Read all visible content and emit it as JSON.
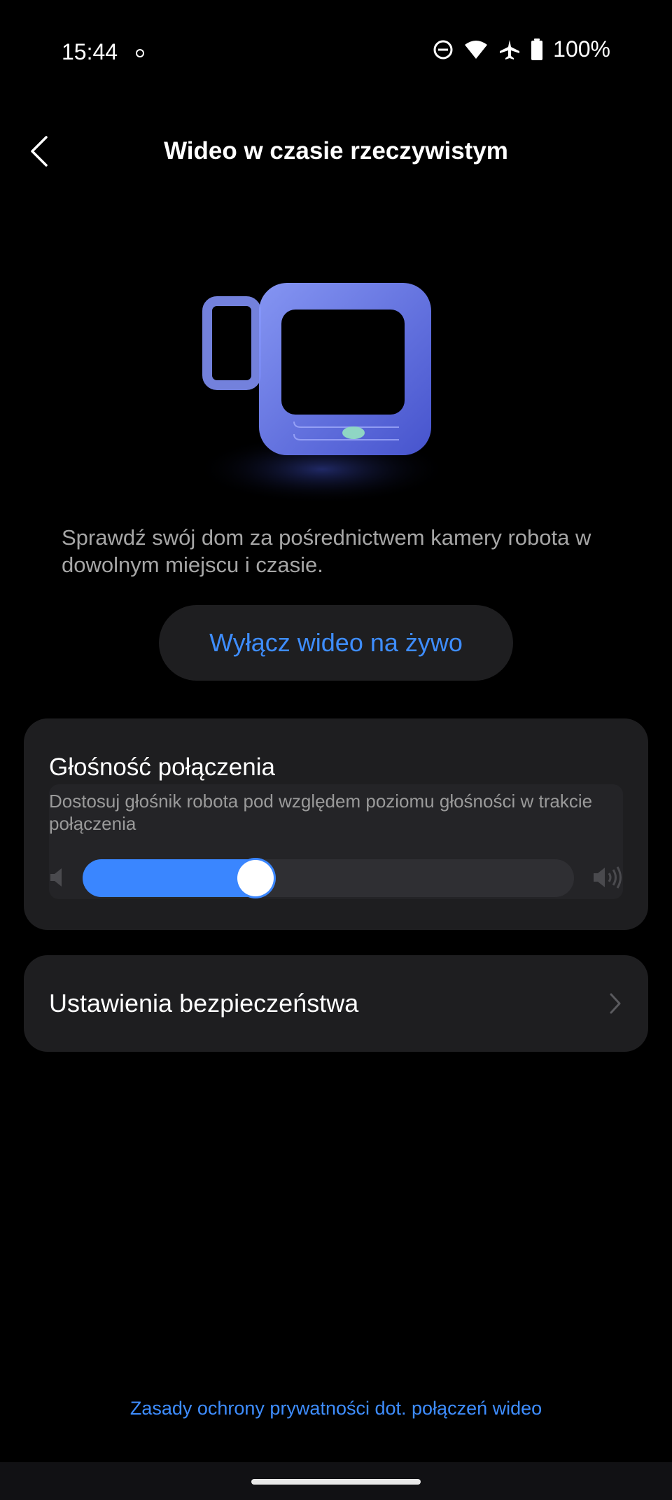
{
  "status_bar": {
    "time": "15:44",
    "battery": "100%",
    "icons": [
      "dnd-icon",
      "wifi-icon",
      "airplane-icon",
      "battery-icon"
    ]
  },
  "header": {
    "title": "Wideo w czasie rzeczywistym",
    "back_icon": "back-chevron-icon"
  },
  "main": {
    "description": "Sprawdź swój dom za pośrednictwem kamery robota w dowolnym miejscu i czasie.",
    "live_button_label": "Wyłącz wideo na żywo"
  },
  "volume": {
    "title": "Głośność połączenia",
    "description": "Dostosuj głośnik robota pod względem poziomu głośności w trakcie połączenia",
    "level": 0.34
  },
  "security": {
    "label": "Ustawienia bezpieczeństwa"
  },
  "footer": {
    "privacy_link": "Zasady ochrony prywatności dot. połączeń wideo"
  },
  "colors": {
    "accent": "#3e8dff",
    "card_bg": "#1e1e20",
    "background": "#000000"
  }
}
